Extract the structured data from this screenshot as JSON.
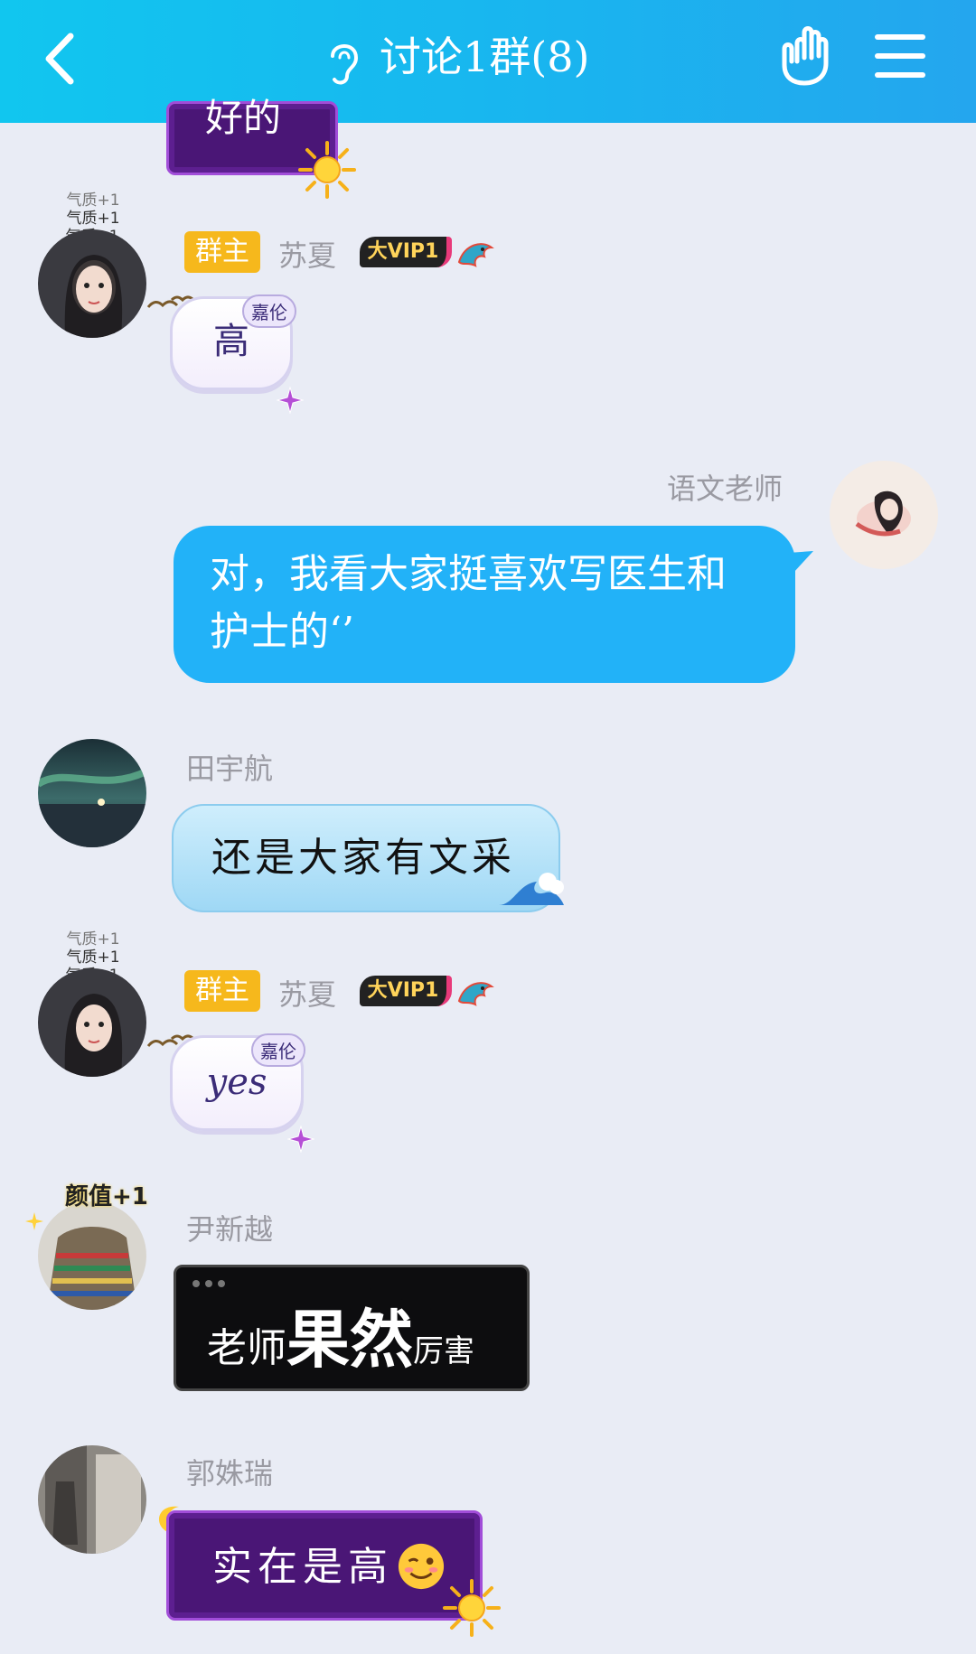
{
  "header": {
    "title": "讨论1群(8)"
  },
  "messages": [
    {
      "type": "incoming",
      "text": "好的"
    },
    {
      "type": "incoming",
      "badge": "群主",
      "name": "苏夏",
      "vip": "大VIP1",
      "avatar_tag": "气质+1",
      "bubble_tag": "嘉伦",
      "text": "高"
    },
    {
      "type": "outgoing",
      "name": "语文老师",
      "text": "对，我看大家挺喜欢写医生和护士的‘’"
    },
    {
      "type": "incoming",
      "name": "田宇航",
      "text": "还是大家有文采"
    },
    {
      "type": "incoming",
      "badge": "群主",
      "name": "苏夏",
      "vip": "大VIP1",
      "avatar_tag": "气质+1",
      "bubble_tag": "嘉伦",
      "text": "yes"
    },
    {
      "type": "incoming",
      "name": "尹新越",
      "avatar_tag": "颜值+1",
      "text_parts": [
        "老师",
        "果然",
        "厉害"
      ]
    },
    {
      "type": "incoming",
      "name": "郭姝瑞",
      "text": "实在是高"
    }
  ],
  "colors": {
    "header": "#19b5ef",
    "background": "#e9ecf5",
    "outgoing_bubble": "#22b2f8",
    "owner_badge": "#f6b81c"
  }
}
